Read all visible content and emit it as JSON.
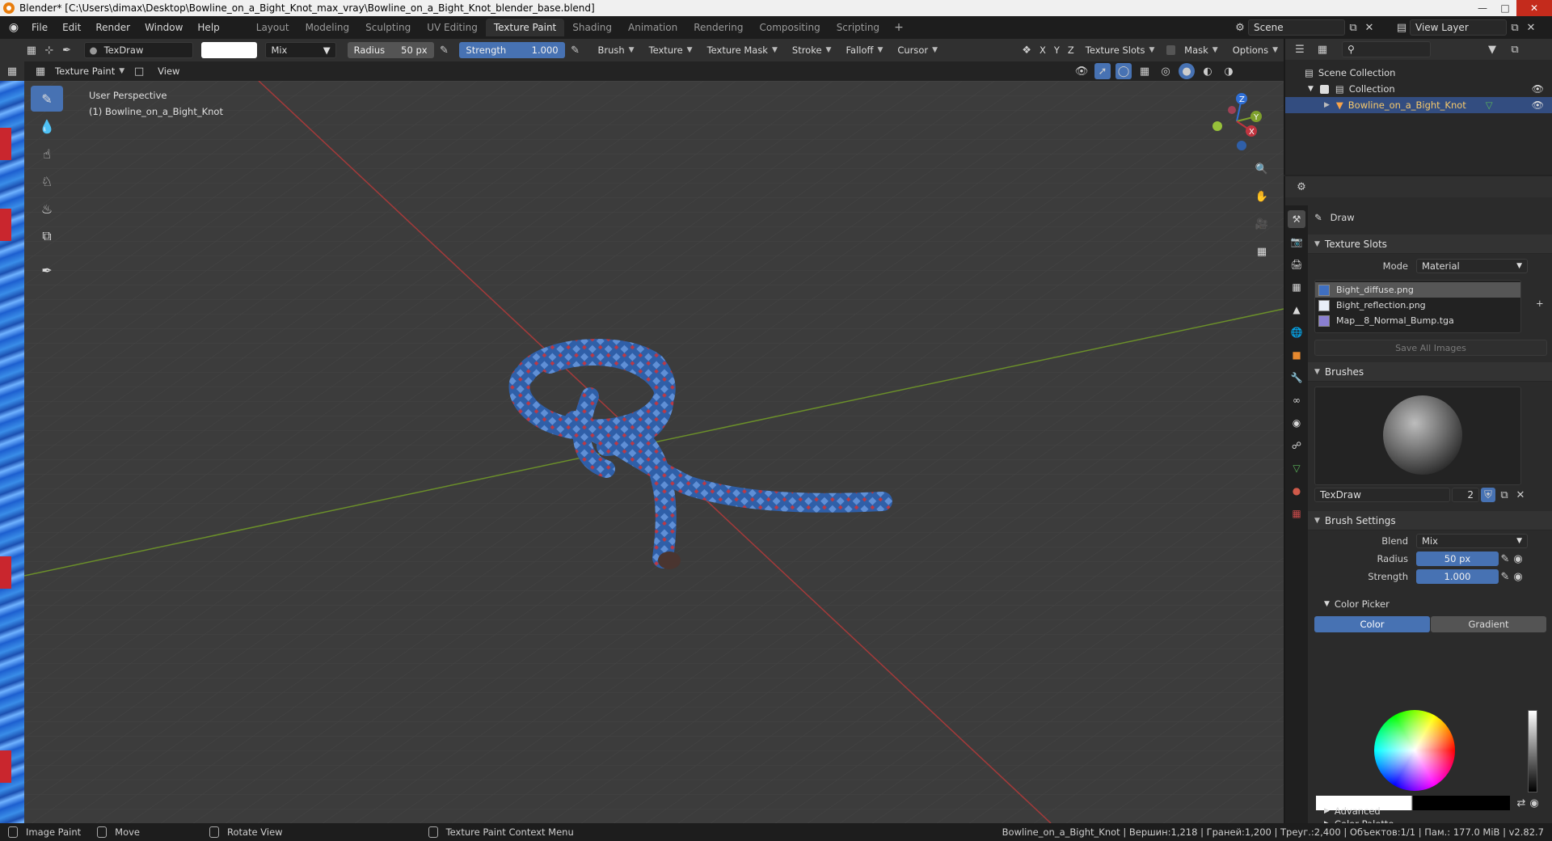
{
  "window": {
    "title": "Blender* [C:\\Users\\dimax\\Desktop\\Bowline_on_a_Bight_Knot_max_vray\\Bowline_on_a_Bight_Knot_blender_base.blend]"
  },
  "menu": [
    "File",
    "Edit",
    "Render",
    "Window",
    "Help"
  ],
  "workspaces": [
    "Layout",
    "Modeling",
    "Sculpting",
    "UV Editing",
    "Texture Paint",
    "Shading",
    "Animation",
    "Rendering",
    "Compositing",
    "Scripting"
  ],
  "active_workspace": "Texture Paint",
  "scene": "Scene",
  "view_layer": "View Layer",
  "header": {
    "brush_name": "TexDraw",
    "blend": "Mix",
    "radius_label": "Radius",
    "radius_value": "50 px",
    "strength_label": "Strength",
    "strength_value": "1.000",
    "menus": [
      "Brush",
      "Texture",
      "Texture Mask",
      "Stroke",
      "Falloff",
      "Cursor"
    ],
    "axes": [
      "X",
      "Y",
      "Z"
    ],
    "texture_slots": "Texture Slots",
    "mask": "Mask",
    "options": "Options"
  },
  "header2": {
    "mode": "Texture Paint",
    "view": "View"
  },
  "viewport": {
    "perspective": "User Perspective",
    "object": "(1) Bowline_on_a_Bight_Knot"
  },
  "outliner": {
    "root": "Scene Collection",
    "collection": "Collection",
    "object": "Bowline_on_a_Bight_Knot"
  },
  "properties": {
    "tool": "Draw",
    "texture_slots_title": "Texture Slots",
    "mode_label": "Mode",
    "mode_value": "Material",
    "textures": [
      "Bight_diffuse.png",
      "Bight_reflection.png",
      "Map__8_Normal_Bump.tga"
    ],
    "save_all": "Save All Images",
    "brushes_title": "Brushes",
    "brush_name": "TexDraw",
    "brush_users": "2",
    "brush_settings_title": "Brush Settings",
    "blend_label": "Blend",
    "blend_value": "Mix",
    "radius_label": "Radius",
    "radius_value": "50 px",
    "strength_label": "Strength",
    "strength_value": "1.000",
    "color_picker_title": "Color Picker",
    "color_tab": "Color",
    "gradient_tab": "Gradient",
    "color_palette": "Color Palette",
    "advanced": "Advanced"
  },
  "status": {
    "image_paint": "Image Paint",
    "move": "Move",
    "rotate_view": "Rotate View",
    "context_menu": "Texture Paint Context Menu",
    "info": "Bowline_on_a_Bight_Knot | Вершин:1,218 | Граней:1,200 | Треуг.:2,400 | Объектов:1/1 | Пам.: 177.0 MiB | v2.82.7"
  },
  "colors": {
    "accent": "#4772b3",
    "selection": "#334d80",
    "rope_blue": "#2f5fa8",
    "rope_red": "#b83a48",
    "axis_red": "#a53a3a",
    "axis_green": "#6b8f2a"
  }
}
